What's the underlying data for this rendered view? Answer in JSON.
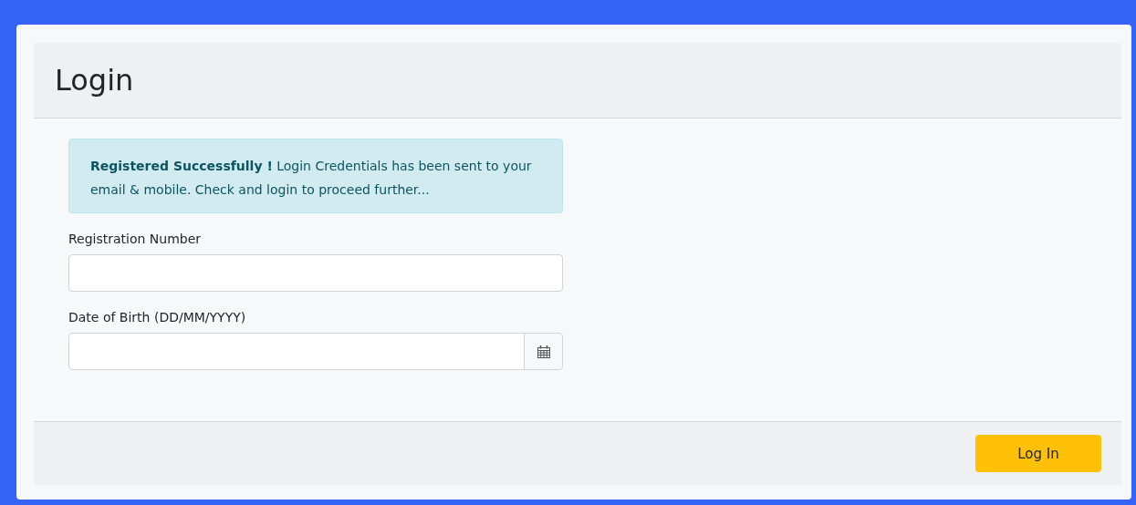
{
  "panel": {
    "title": "Login"
  },
  "alert": {
    "text": "**Registered Successfully !** Login Credentials has been sent to your email & mobile. Check and login to proceed further..."
  },
  "fields": [
    {
      "label": "Registration Number",
      "kind": "text"
    },
    {
      "label": "Date of Birth (DD/MM/YYYY)",
      "kind": "date"
    }
  ],
  "footer": {
    "button": "Log In"
  }
}
